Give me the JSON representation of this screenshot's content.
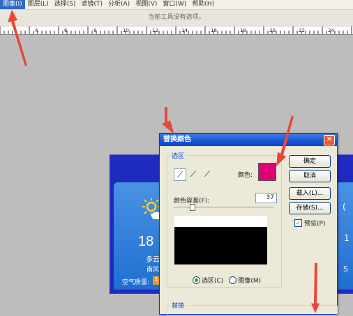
{
  "menubar": {
    "items": [
      "图像(I)",
      "图层(L)",
      "选择(S)",
      "滤镜(T)",
      "分析(A)",
      "视图(V)",
      "窗口(W)",
      "帮助(H)"
    ],
    "active_index": 0
  },
  "options_bar": {
    "text": "当前工具没有选项。"
  },
  "ruler": {
    "labels": [
      "4",
      "6",
      "8",
      "10",
      "12",
      "14",
      "16",
      "18",
      "20",
      "22",
      "24"
    ]
  },
  "document": {
    "temperature": "18",
    "condition": "多云",
    "wind": "南风",
    "air_quality_label": "空气质量:",
    "air_quality_badge": "1"
  },
  "dialog": {
    "title": "替换颜色",
    "close_symbol": "✕",
    "selection_group_label": "选区",
    "color_label": "颜色:",
    "selected_color": "#e00075",
    "tolerance_label": "颜色容差(F):",
    "tolerance_value": "37",
    "tolerance_fraction": 0.185,
    "radio_selection": "选区(C)",
    "radio_image": "图像(M)",
    "replace_group_label": "替换",
    "buttons": {
      "ok": "确定",
      "cancel": "取消",
      "load": "载入(L)...",
      "save": "存储(S)..."
    },
    "preview_label": "预览(P)",
    "preview_checked": true
  },
  "colors": {
    "arrow": "#e8473a",
    "title_bar": "#1754d3",
    "swatch": "#e00075"
  }
}
